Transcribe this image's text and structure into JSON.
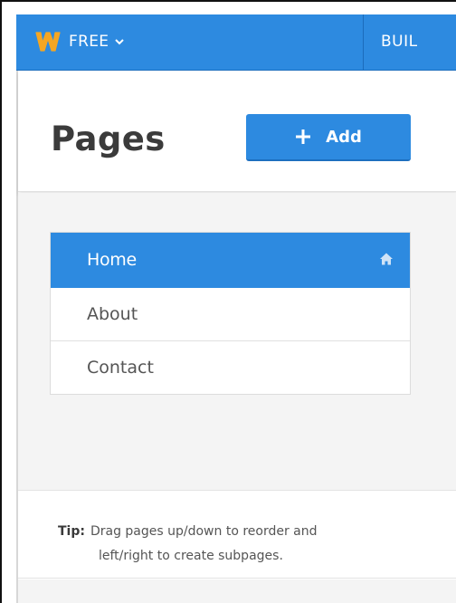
{
  "topbar": {
    "plan_label": "FREE",
    "builder_tab_label": "BUIL",
    "logo_icon": "weebly-w-logo",
    "color": "#2d8ae0"
  },
  "pages_panel": {
    "title": "Pages",
    "add_button_label": "Add",
    "items": [
      {
        "label": "Home",
        "active": true,
        "icon": "home-icon"
      },
      {
        "label": "About",
        "active": false
      },
      {
        "label": "Contact",
        "active": false
      }
    ]
  },
  "tip": {
    "label": "Tip:",
    "line1": "Drag pages up/down to reorder and",
    "line2": "left/right to create subpages."
  }
}
